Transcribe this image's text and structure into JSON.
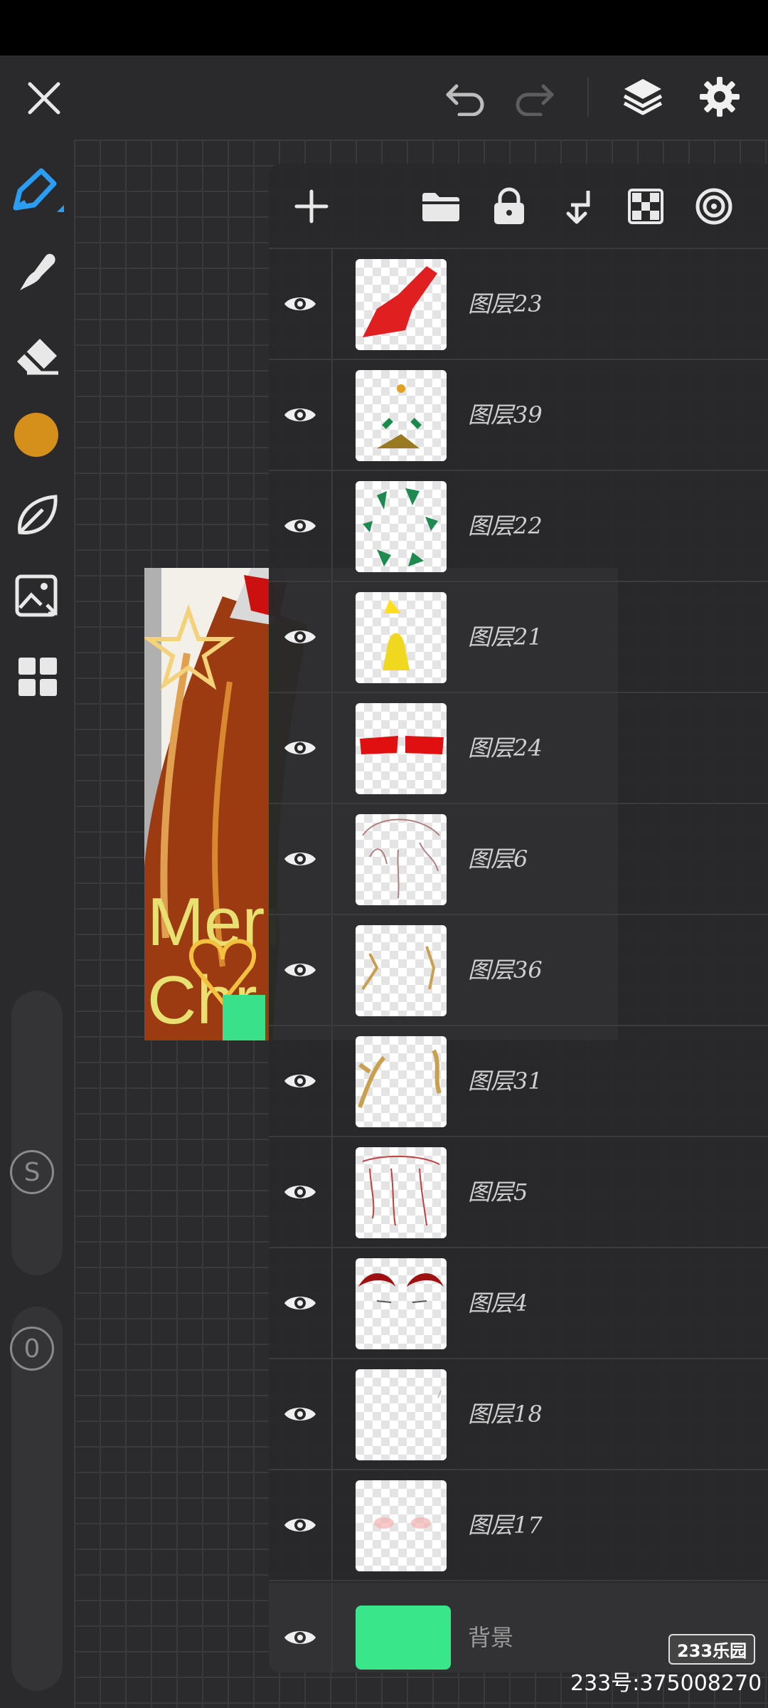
{
  "layers": [
    {
      "name": "图层23"
    },
    {
      "name": "图层39"
    },
    {
      "name": "图层22"
    },
    {
      "name": "图层21"
    },
    {
      "name": "图层24"
    },
    {
      "name": "图层6"
    },
    {
      "name": "图层36"
    },
    {
      "name": "图层31"
    },
    {
      "name": "图层5"
    },
    {
      "name": "图层4"
    },
    {
      "name": "图层18"
    },
    {
      "name": "图层17"
    }
  ],
  "background_layer": {
    "name": "背景",
    "color": "#3ae68a"
  },
  "brush_color": "#d4901a",
  "accent_color": "#2a9df4",
  "artwork_text": {
    "line1": "Merr",
    "line2": "Chr"
  },
  "sidebar": {
    "icons": [
      "brush-icon",
      "smudge-icon",
      "eraser-icon",
      "color-swatch",
      "leaf-icon",
      "image-import-icon",
      "grid-menu-icon"
    ],
    "size_slider_badge": "S",
    "opacity_slider_badge": "0"
  },
  "watermark": {
    "logo": "233乐园",
    "text": "233号:375008270"
  }
}
